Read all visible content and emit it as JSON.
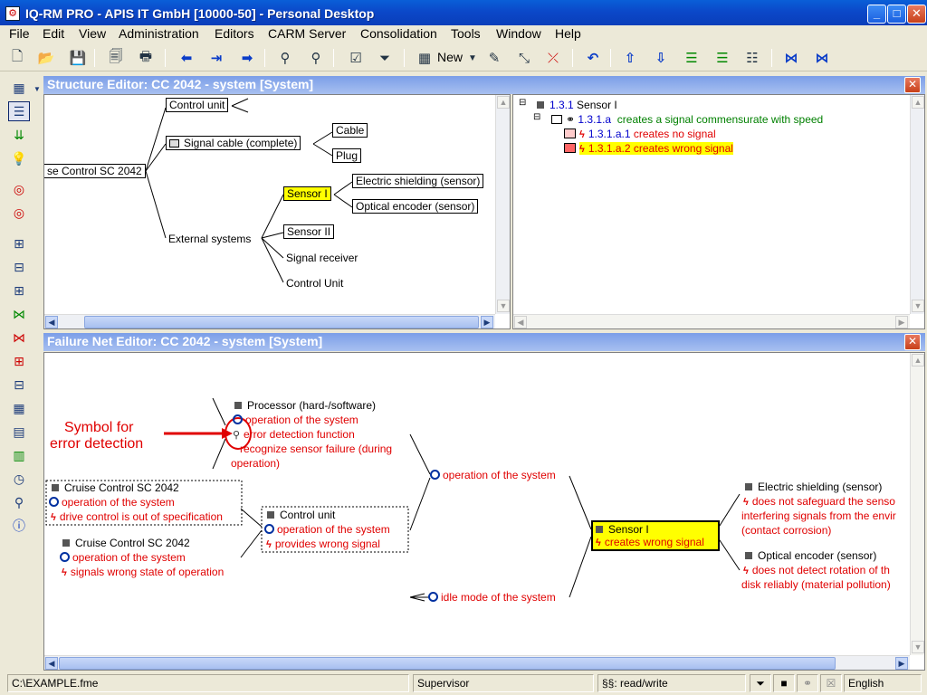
{
  "window": {
    "title": "IQ-RM PRO - APIS IT GmbH [10000-50] - Personal Desktop"
  },
  "menu": [
    "File",
    "Edit",
    "View",
    "Administration",
    "Editors",
    "CARM Server",
    "Consolidation",
    "Tools",
    "Window",
    "Help"
  ],
  "toolbar": {
    "new_label": "New"
  },
  "structure_editor": {
    "title": "Structure Editor: CC 2042 - system [System]",
    "root": "se Control SC 2042",
    "nodes": {
      "control_unit": "Control unit",
      "signal_cable": "Signal cable (complete)",
      "cable": "Cable",
      "plug": "Plug",
      "external_systems": "External systems",
      "sensor_1": "Sensor I",
      "electric_shielding": "Electric shielding (sensor)",
      "optical_encoder": "Optical encoder (sensor)",
      "sensor_2": "Sensor II",
      "signal_receiver": "Signal receiver",
      "control_unit_2": "Control Unit"
    }
  },
  "function_tree": {
    "l1": {
      "num": "1.3.1",
      "label": "Sensor I"
    },
    "l2": {
      "num": "1.3.1.a",
      "label": "creates a signal commensurate with speed"
    },
    "l3a": {
      "num": "1.3.1.a.1",
      "label": "creates no signal"
    },
    "l3b": {
      "num": "1.3.1.a.2",
      "label": "creates wrong signal"
    }
  },
  "failure_net": {
    "title": "Failure Net Editor: CC 2042 - system [System]",
    "annotation": [
      "Symbol for",
      "error detection"
    ],
    "processor": {
      "name": "Processor (hard-/software)",
      "func": "operation of the system",
      "detect": "error detection function",
      "detect2": "recognize sensor failure (during",
      "detect3": "operation)"
    },
    "cruise1": {
      "name": "Cruise Control SC 2042",
      "func": "operation of the system",
      "fail": "drive control is out of specification"
    },
    "cruise2": {
      "name": "Cruise Control SC 2042",
      "func": "operation of the system",
      "fail": "signals wrong state of operation"
    },
    "control_unit": {
      "name": "Control unit",
      "func": "operation of the system",
      "fail": "provides wrong signal"
    },
    "op_system": "operation of the system",
    "idle_mode": "idle mode of the system",
    "sensor1": {
      "name": "Sensor I",
      "fail": "creates wrong signal"
    },
    "shielding": {
      "name": "Electric shielding (sensor)",
      "fail1": "does not safeguard the senso",
      "fail2": "interfering signals from the envir",
      "fail3": "(contact corrosion)"
    },
    "encoder": {
      "name": "Optical encoder (sensor)",
      "fail1": "does not detect rotation of th",
      "fail2": "disk reliably (material pollution)"
    }
  },
  "status": {
    "file": "C:\\EXAMPLE.fme",
    "user": "Supervisor",
    "access": "§§: read/write",
    "language": "English"
  }
}
